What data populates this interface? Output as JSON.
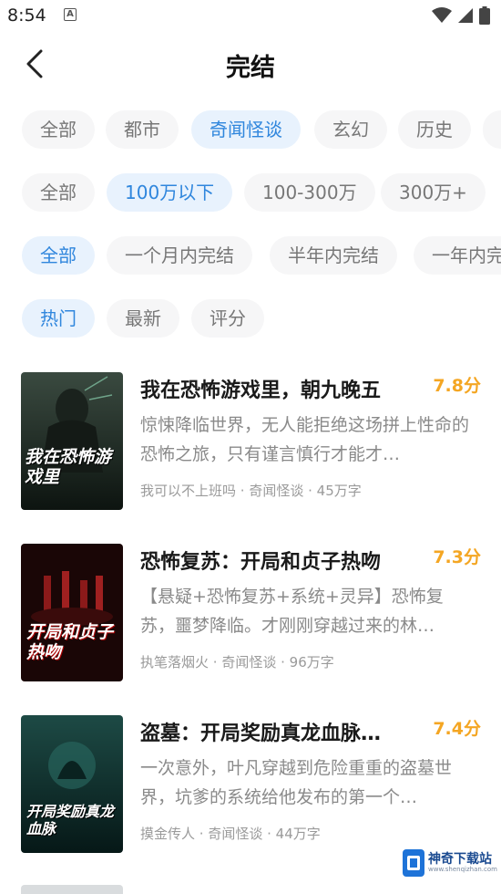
{
  "status_bar": {
    "time": "8:54",
    "notification_icon": "A"
  },
  "header": {
    "title": "完结"
  },
  "filters": {
    "category": [
      "全部",
      "都市",
      "奇闻怪谈",
      "玄幻",
      "历史"
    ],
    "word_count": [
      "全部",
      "100万以下",
      "100-300万",
      "300万+"
    ],
    "completion_time": [
      "全部",
      "一个月内完结",
      "半年内完结",
      "一年内完"
    ],
    "sort": [
      "热门",
      "最新",
      "评分"
    ]
  },
  "books": [
    {
      "title": "我在恐怖游戏里，朝九晚五",
      "score": "7.8分",
      "description": "惊悚降临世界，无人能拒绝这场拼上性命的恐怖之旅，只有谨言慎行才能才…",
      "author": "我可以不上班吗",
      "genre": "奇闻怪谈",
      "words": "45万字",
      "cover_text": "我在恐怖游戏里"
    },
    {
      "title": "恐怖复苏：开局和贞子热吻",
      "score": "7.3分",
      "description": "【悬疑+恐怖复苏+系统+灵异】恐怖复苏，噩梦降临。才刚刚穿越过来的林…",
      "author": "执笔落烟火",
      "genre": "奇闻怪谈",
      "words": "96万字",
      "cover_text": "开局和贞子热吻"
    },
    {
      "title": "盗墓：开局奖励真龙血脉…",
      "score": "7.4分",
      "description": "一次意外，叶凡穿越到危险重重的盗墓世界，坑爹的系统给他发布的第一个…",
      "author": "摸金传人",
      "genre": "奇闻怪谈",
      "words": "44万字",
      "cover_text": "开局奖励真龙血脉"
    }
  ],
  "meta_separator": " · ",
  "watermark": {
    "text": "神奇下载站",
    "sub": "www.shenqizhan.com"
  },
  "colors": {
    "accent": "#2f86dd",
    "score": "#f4a623",
    "chip_bg": "#f6f6f7",
    "chip_active_bg": "#e8f2fd"
  }
}
